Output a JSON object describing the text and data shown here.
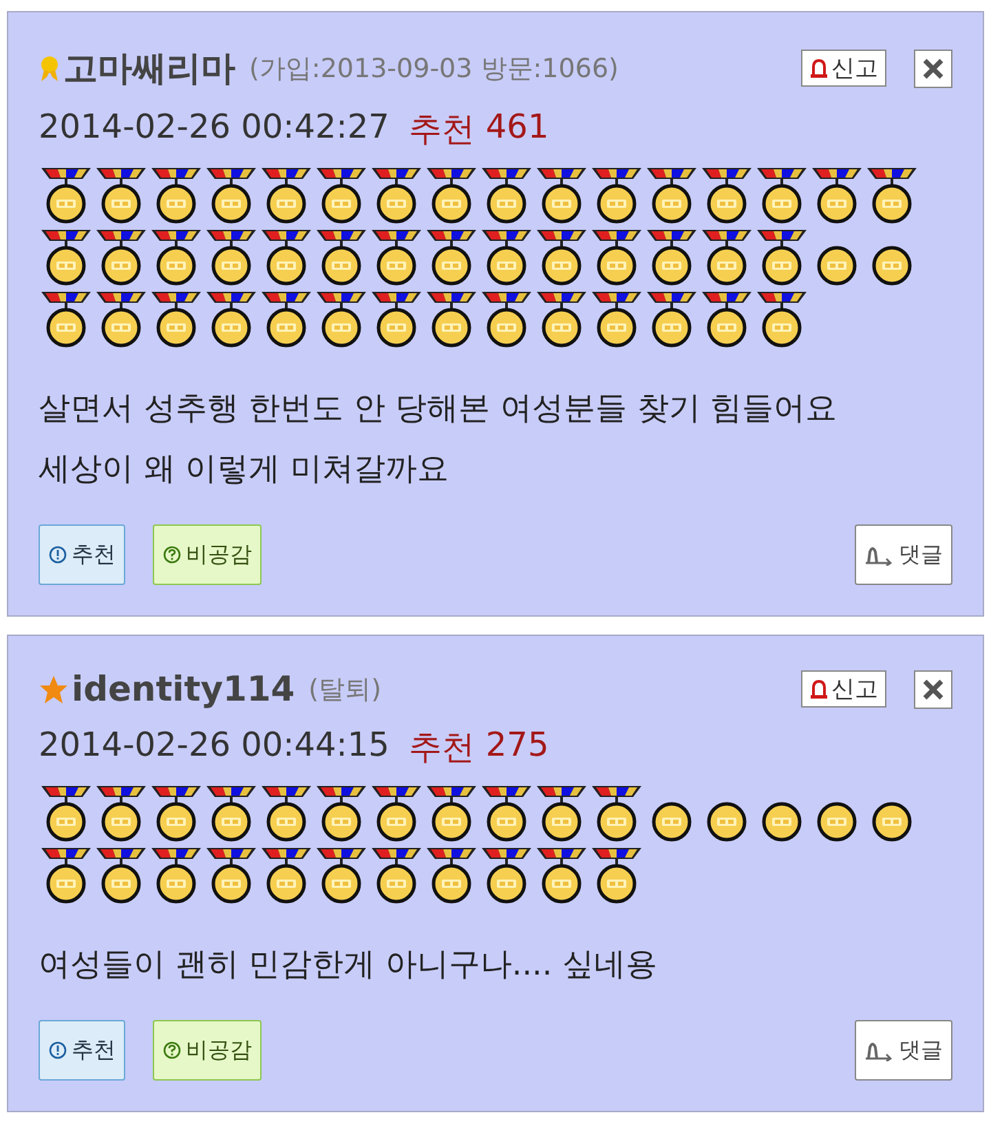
{
  "comments": [
    {
      "badge": {
        "kind": "ribbon"
      },
      "author": "고마쌔리마",
      "meta": "(가입:2013-09-03 방문:1066)",
      "report": "신고",
      "timestamp": "2014-02-26 00:42:27",
      "recommend_label": "추천",
      "recommend_count": "461",
      "medals": [
        {
          "kind": "ribbon"
        },
        {
          "kind": "ribbon"
        },
        {
          "kind": "ribbon"
        },
        {
          "kind": "ribbon"
        },
        {
          "kind": "ribbon"
        },
        {
          "kind": "ribbon"
        },
        {
          "kind": "ribbon"
        },
        {
          "kind": "ribbon"
        },
        {
          "kind": "ribbon"
        },
        {
          "kind": "ribbon"
        },
        {
          "kind": "ribbon"
        },
        {
          "kind": "ribbon"
        },
        {
          "kind": "ribbon"
        },
        {
          "kind": "ribbon"
        },
        {
          "kind": "ribbon"
        },
        {
          "kind": "ribbon"
        },
        {
          "kind": "ribbon"
        },
        {
          "kind": "ribbon"
        },
        {
          "kind": "ribbon"
        },
        {
          "kind": "ribbon"
        },
        {
          "kind": "ribbon"
        },
        {
          "kind": "ribbon"
        },
        {
          "kind": "ribbon"
        },
        {
          "kind": "ribbon"
        },
        {
          "kind": "ribbon"
        },
        {
          "kind": "ribbon"
        },
        {
          "kind": "ribbon"
        },
        {
          "kind": "ribbon"
        },
        {
          "kind": "ribbon"
        },
        {
          "kind": "ribbon"
        },
        {
          "kind": "plain"
        },
        {
          "kind": "plain"
        },
        {
          "kind": "ribbon"
        },
        {
          "kind": "ribbon"
        },
        {
          "kind": "ribbon"
        },
        {
          "kind": "ribbon"
        },
        {
          "kind": "ribbon"
        },
        {
          "kind": "ribbon"
        },
        {
          "kind": "ribbon"
        },
        {
          "kind": "ribbon"
        },
        {
          "kind": "ribbon"
        },
        {
          "kind": "ribbon"
        },
        {
          "kind": "ribbon"
        },
        {
          "kind": "ribbon"
        },
        {
          "kind": "ribbon"
        },
        {
          "kind": "ribbon"
        }
      ],
      "body": [
        "살면서 성추행 한번도 안 당해본 여성분들 찾기 힘들어요",
        "세상이 왜 이렇게 미쳐갈까요"
      ],
      "recommend_button": "추천",
      "disagree_button": "비공감",
      "reply_button": "댓글"
    },
    {
      "badge": {
        "kind": "star"
      },
      "author": "identity114",
      "meta": "(탈퇴)",
      "report": "신고",
      "timestamp": "2014-02-26 00:44:15",
      "recommend_label": "추천",
      "recommend_count": "275",
      "medals": [
        {
          "kind": "ribbon"
        },
        {
          "kind": "ribbon"
        },
        {
          "kind": "ribbon"
        },
        {
          "kind": "ribbon"
        },
        {
          "kind": "ribbon"
        },
        {
          "kind": "ribbon"
        },
        {
          "kind": "ribbon"
        },
        {
          "kind": "ribbon"
        },
        {
          "kind": "ribbon"
        },
        {
          "kind": "ribbon"
        },
        {
          "kind": "ribbon"
        },
        {
          "kind": "plain"
        },
        {
          "kind": "plain"
        },
        {
          "kind": "plain"
        },
        {
          "kind": "plain"
        },
        {
          "kind": "plain"
        },
        {
          "kind": "ribbon"
        },
        {
          "kind": "ribbon"
        },
        {
          "kind": "ribbon"
        },
        {
          "kind": "ribbon"
        },
        {
          "kind": "ribbon"
        },
        {
          "kind": "ribbon"
        },
        {
          "kind": "ribbon"
        },
        {
          "kind": "ribbon"
        },
        {
          "kind": "ribbon"
        },
        {
          "kind": "ribbon"
        },
        {
          "kind": "ribbon"
        }
      ],
      "body": [
        "여성들이 괜히 민감한게 아니구나.... 싶네용"
      ],
      "recommend_button": "추천",
      "disagree_button": "비공감",
      "reply_button": "댓글"
    }
  ]
}
